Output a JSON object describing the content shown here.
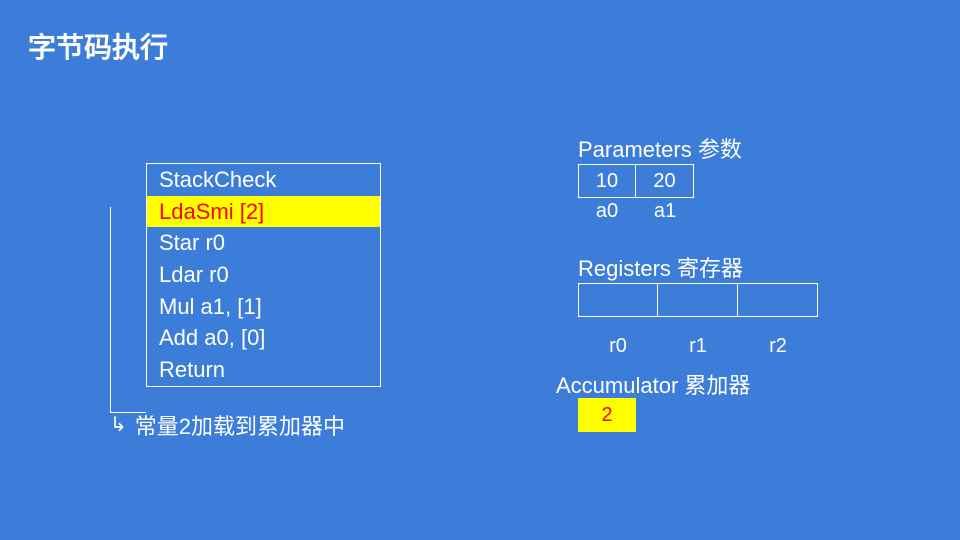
{
  "title": "字节码执行",
  "bytecode": {
    "lines": [
      {
        "text": "StackCheck",
        "highlight": false
      },
      {
        "text": "LdaSmi [2]",
        "highlight": true
      },
      {
        "text": "Star r0",
        "highlight": false
      },
      {
        "text": "Ldar r0",
        "highlight": false
      },
      {
        "text": "Mul a1, [1]",
        "highlight": false
      },
      {
        "text": "Add a0, [0]",
        "highlight": false
      },
      {
        "text": "Return",
        "highlight": false
      }
    ]
  },
  "annotation": {
    "arrow": "↳",
    "text": "常量2加载到累加器中"
  },
  "parameters": {
    "label": "Parameters 参数",
    "cells": [
      {
        "value": "10",
        "name": "a0"
      },
      {
        "value": "20",
        "name": "a1"
      }
    ]
  },
  "registers": {
    "label": "Registers 寄存器",
    "cells": [
      {
        "value": "",
        "name": "r0"
      },
      {
        "value": "",
        "name": "r1"
      },
      {
        "value": "",
        "name": "r2"
      }
    ]
  },
  "accumulator": {
    "label": "Accumulator 累加器",
    "value": "2"
  }
}
